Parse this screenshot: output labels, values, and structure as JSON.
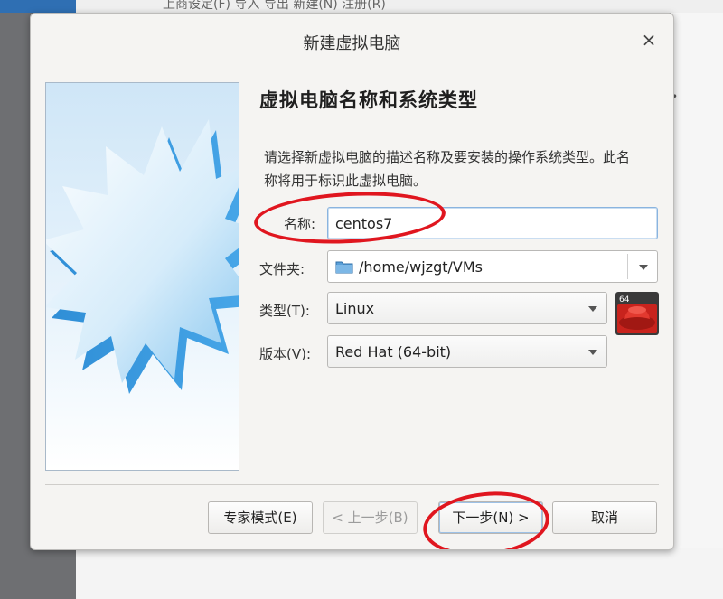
{
  "background": {
    "menu_text": "上商设定(F)   导入  导出   新建(N)   注册(R)"
  },
  "dialog": {
    "title": "新建虚拟电脑",
    "close_glyph": "×"
  },
  "page": {
    "heading": "虚拟电脑名称和系统类型",
    "description": "请选择新虚拟电脑的描述名称及要安装的操作系统类型。此名称将用于标识此虚拟电脑。"
  },
  "form": {
    "name_label": "名称:",
    "name_value": "centos7",
    "folder_label": "文件夹:",
    "folder_value": "/home/wjzgt/VMs",
    "type_label": "类型(T):",
    "type_value": "Linux",
    "version_label": "版本(V):",
    "version_value": "Red Hat (64-bit)",
    "os_badge": "64"
  },
  "buttons": {
    "expert": "专家模式(E)",
    "back": "< 上一步(B)",
    "next": "下一步(N) >",
    "cancel": "取消"
  },
  "colors": {
    "annotation_red": "#e0161f",
    "wizard_blue": "#3c9ee0"
  }
}
